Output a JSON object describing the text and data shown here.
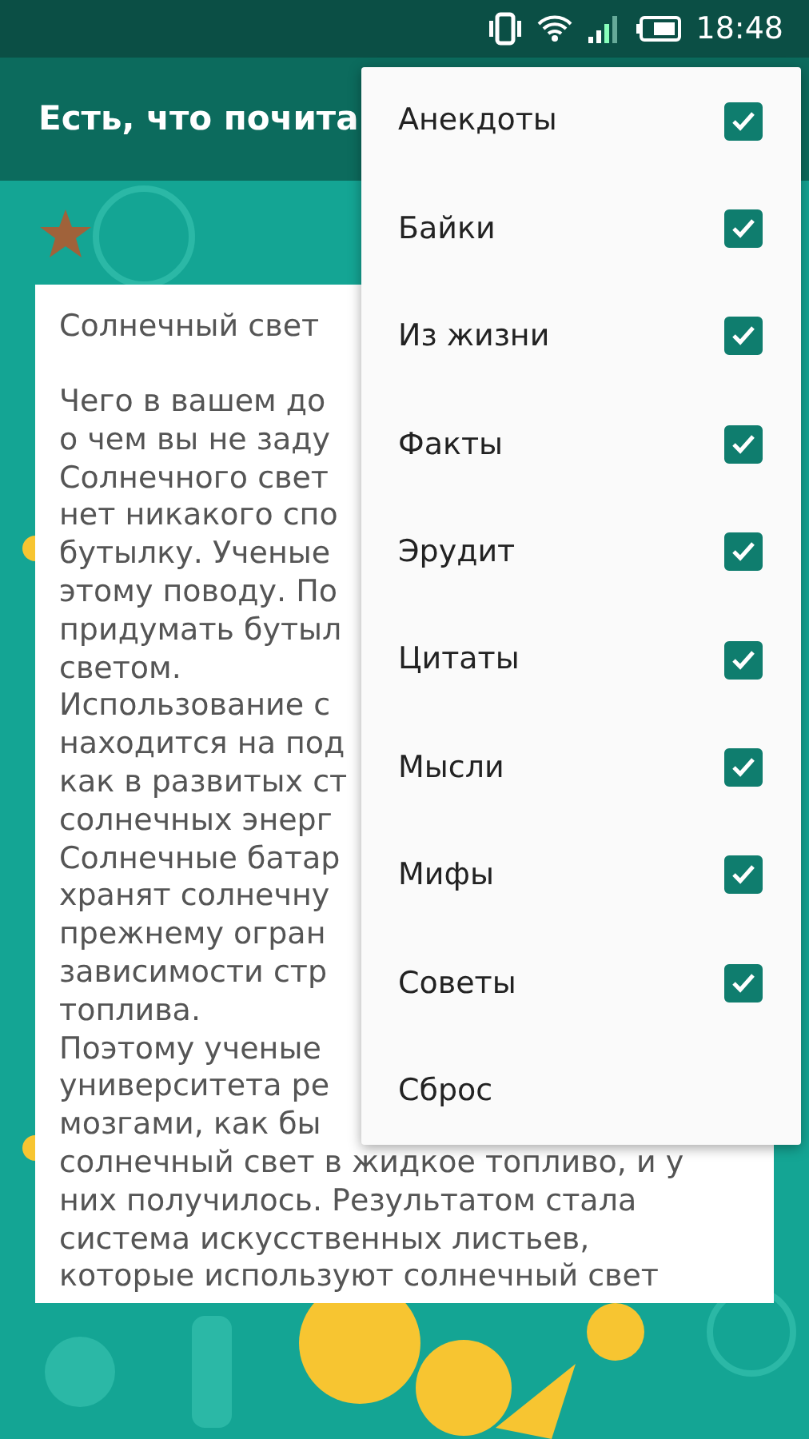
{
  "status_bar": {
    "time": "18:48"
  },
  "app_bar": {
    "title": "Есть, что почита"
  },
  "article": {
    "title": "Солнечный свет",
    "lines": [
      "Чего в вашем до",
      "о чем вы не заду",
      "Солнечного свет",
      "нет никакого спо",
      "бутылку. Ученые",
      "этому поводу. По",
      "придумать бутыл",
      "светом.",
      "Использование с",
      "находится на под",
      "как в развитых ст",
      "солнечных энерг",
      "Солнечные батар",
      "хранят солнечну",
      "прежнему огран",
      "зависимости стр",
      "топлива.",
      "Поэтому ученые",
      "университета ре",
      "мозгами, как бы",
      "солнечный свет в жидкое топливо, и у",
      "них получилось. Результатом стала",
      "система искусственных листьев,",
      "которые используют солнечный свет"
    ]
  },
  "menu": {
    "items": [
      {
        "kind": "check",
        "label": "Анекдоты",
        "checked": true
      },
      {
        "kind": "check",
        "label": "Байки",
        "checked": true
      },
      {
        "kind": "check",
        "label": "Из жизни",
        "checked": true
      },
      {
        "kind": "check",
        "label": "Факты",
        "checked": true
      },
      {
        "kind": "check",
        "label": "Эрудит",
        "checked": true
      },
      {
        "kind": "check",
        "label": "Цитаты",
        "checked": true
      },
      {
        "kind": "check",
        "label": "Мысли",
        "checked": true
      },
      {
        "kind": "check",
        "label": "Мифы",
        "checked": true
      },
      {
        "kind": "check",
        "label": "Советы",
        "checked": true
      },
      {
        "kind": "action",
        "label": "Сброс"
      }
    ]
  }
}
